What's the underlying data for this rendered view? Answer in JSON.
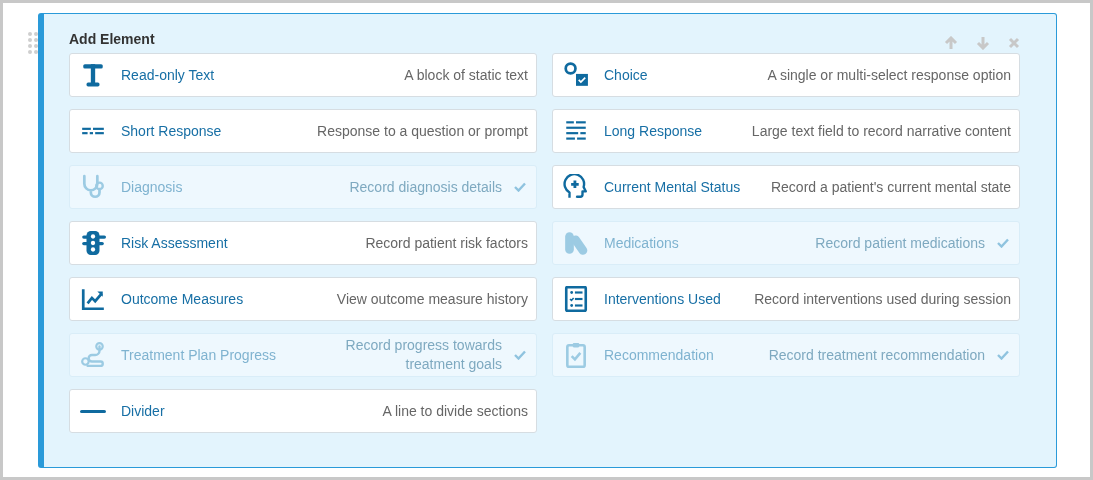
{
  "panel": {
    "title": "Add Element"
  },
  "elements": [
    {
      "name": "Read-only Text",
      "description": "A block of static text",
      "disabled": false
    },
    {
      "name": "Choice",
      "description": "A single or multi-select response option",
      "disabled": false
    },
    {
      "name": "Short Response",
      "description": "Response to a question or prompt",
      "disabled": false
    },
    {
      "name": "Long Response",
      "description": "Large text field to record narrative content",
      "disabled": false
    },
    {
      "name": "Diagnosis",
      "description": "Record diagnosis details",
      "disabled": true
    },
    {
      "name": "Current Mental Status",
      "description": "Record a patient's current mental state",
      "disabled": false
    },
    {
      "name": "Risk Assessment",
      "description": "Record patient risk factors",
      "disabled": false
    },
    {
      "name": "Medications",
      "description": "Record patient medications",
      "disabled": true
    },
    {
      "name": "Outcome Measures",
      "description": "View outcome measure history",
      "disabled": false
    },
    {
      "name": "Interventions Used",
      "description": "Record interventions used during session",
      "disabled": false
    },
    {
      "name": "Treatment Plan Progress",
      "description": "Record progress towards treatment goals",
      "disabled": true
    },
    {
      "name": "Recommendation",
      "description": "Record treatment recommendation",
      "disabled": true
    },
    {
      "name": "Divider",
      "description": "A line to divide sections",
      "disabled": false
    }
  ]
}
